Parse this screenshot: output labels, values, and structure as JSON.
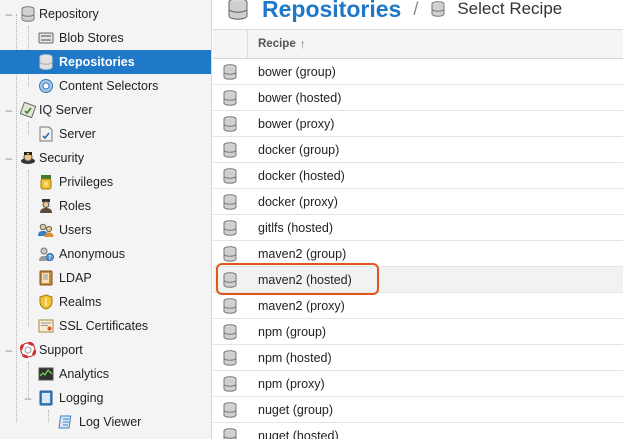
{
  "sidebar": {
    "items": [
      {
        "label": "Repository",
        "icon": "database-icon",
        "toggle": "–"
      },
      {
        "label": "Blob Stores",
        "icon": "blob-store-icon"
      },
      {
        "label": "Repositories",
        "icon": "database-icon",
        "selected": true
      },
      {
        "label": "Content Selectors",
        "icon": "content-selector-icon"
      },
      {
        "label": "IQ Server",
        "icon": "iq-server-icon",
        "toggle": "–"
      },
      {
        "label": "Server",
        "icon": "server-icon"
      },
      {
        "label": "Security",
        "icon": "security-icon",
        "toggle": "–"
      },
      {
        "label": "Privileges",
        "icon": "privileges-icon"
      },
      {
        "label": "Roles",
        "icon": "roles-icon"
      },
      {
        "label": "Users",
        "icon": "users-icon"
      },
      {
        "label": "Anonymous",
        "icon": "anonymous-icon"
      },
      {
        "label": "LDAP",
        "icon": "ldap-icon"
      },
      {
        "label": "Realms",
        "icon": "realms-icon"
      },
      {
        "label": "SSL Certificates",
        "icon": "ssl-certificates-icon"
      },
      {
        "label": "Support",
        "icon": "support-icon",
        "toggle": "–"
      },
      {
        "label": "Analytics",
        "icon": "analytics-icon"
      },
      {
        "label": "Logging",
        "icon": "logging-icon",
        "toggle": "–"
      },
      {
        "label": "Log Viewer",
        "icon": "log-viewer-icon"
      }
    ]
  },
  "breadcrumb": {
    "title": "Repositories",
    "separator": "/",
    "current": "Select Recipe"
  },
  "grid": {
    "column_header": "Recipe",
    "sort_indicator": "↑",
    "rows": [
      "bower (group)",
      "bower (hosted)",
      "bower (proxy)",
      "docker (group)",
      "docker (hosted)",
      "docker (proxy)",
      "gitlfs (hosted)",
      "maven2 (group)",
      "maven2 (hosted)",
      "maven2 (proxy)",
      "npm (group)",
      "npm (hosted)",
      "npm (proxy)",
      "nuget (group)",
      "nuget (hosted)"
    ],
    "highlighted_row": "maven2 (hosted)"
  },
  "colors": {
    "accent": "#1f78c8",
    "highlight_border": "#e0561e"
  }
}
